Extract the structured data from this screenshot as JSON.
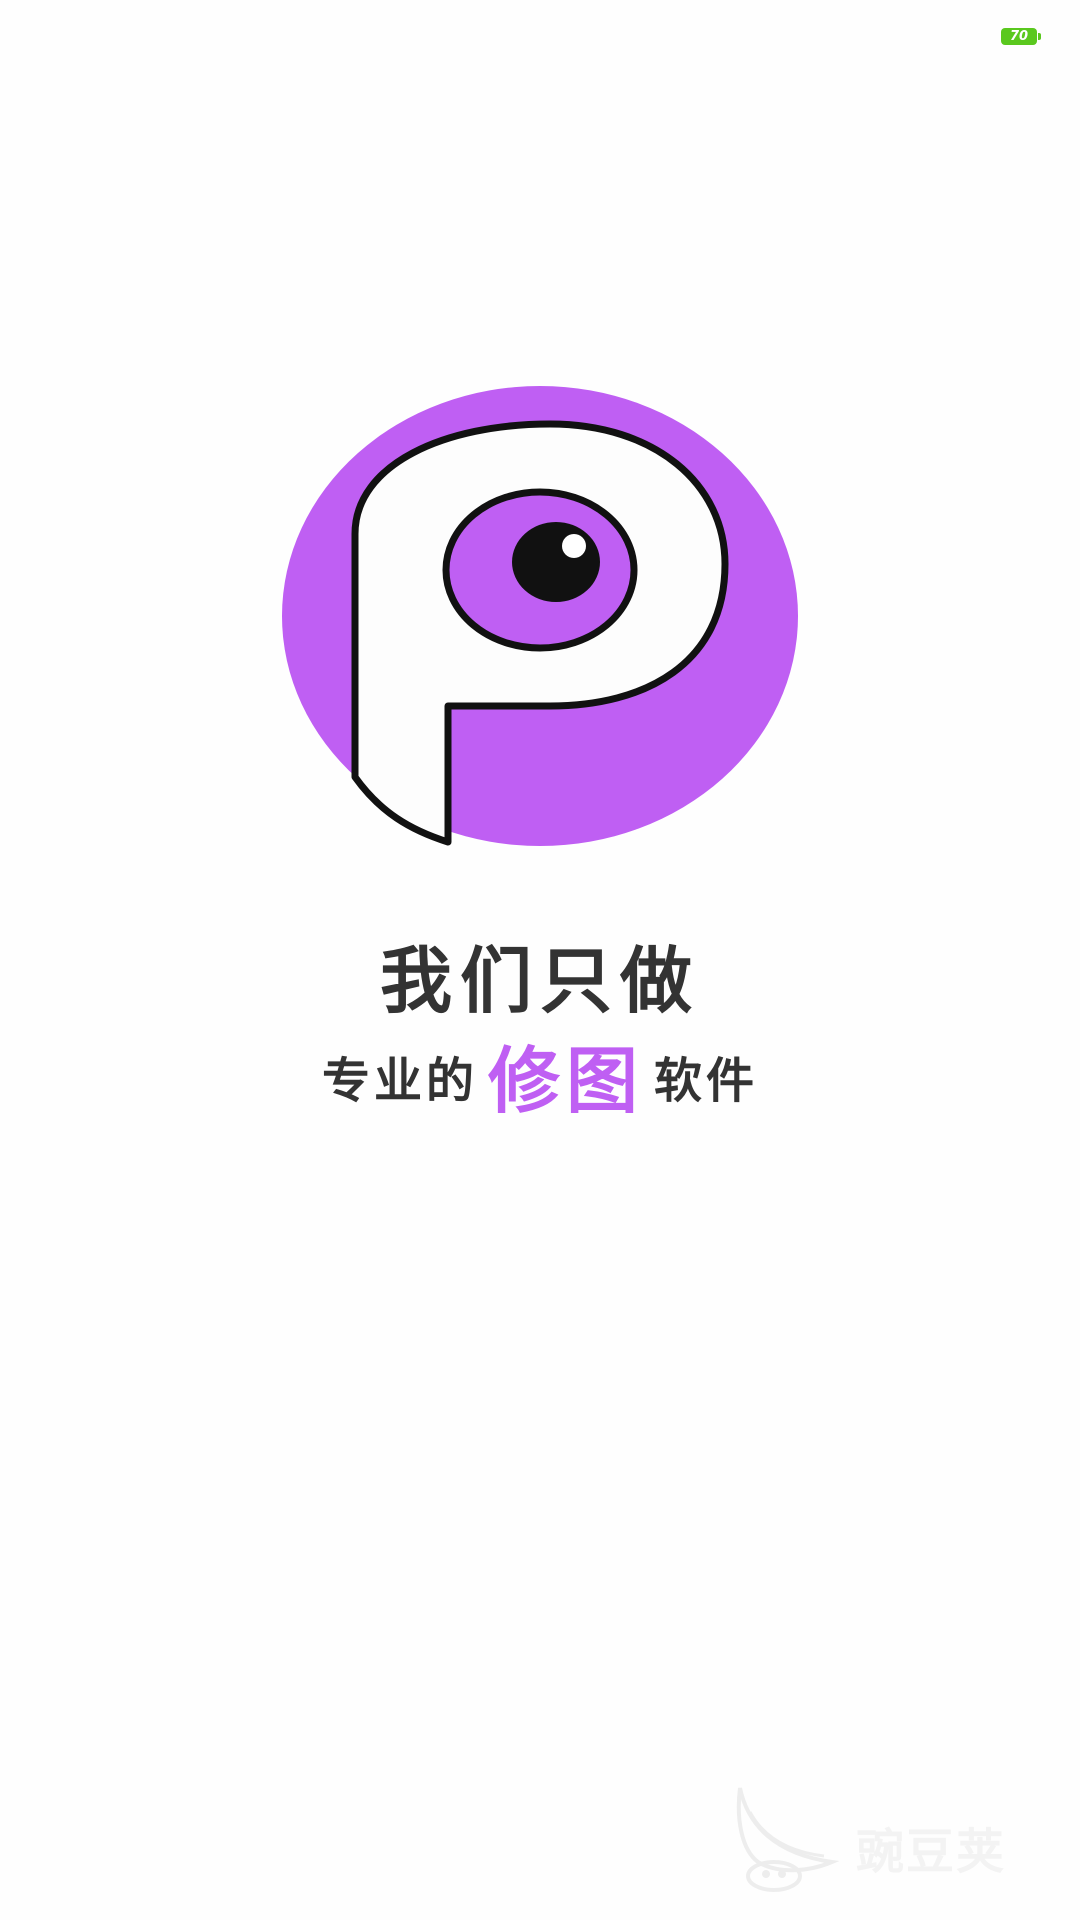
{
  "status_bar": {
    "battery_level": "70",
    "battery_color": "#5ac81e"
  },
  "logo": {
    "icon": "eye-p-logo-icon",
    "primary_color": "#bf5ff3",
    "outline_color": "#111111"
  },
  "slogan": {
    "line1": "我们只做",
    "line2_prefix": "专业的",
    "line2_highlight": "修图",
    "line2_suffix": "软件",
    "highlight_color": "#bf5ff3"
  },
  "watermark": {
    "text": "豌豆荚",
    "icon": "peapod-bird-logo-icon"
  }
}
